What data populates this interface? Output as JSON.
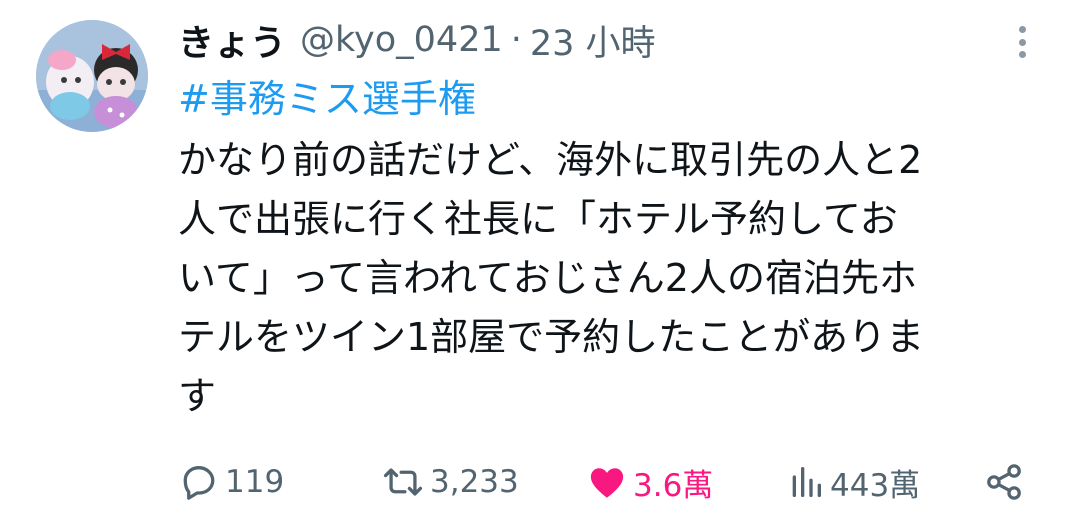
{
  "tweet": {
    "author_name": "きょう",
    "handle": "@kyo_0421",
    "separator": "·",
    "time": "23 小時",
    "hashtag": "#事務ミス選手権",
    "body_lines": [
      "かなり前の話だけど、海外に取引先の人と2",
      "人で出張に行く社長に「ホテル予約してお",
      "いて」って言われておじさん2人の宿泊先ホ",
      "テルをツイン1部屋で予約したことがありま",
      "す"
    ]
  },
  "actions": {
    "reply_count": "119",
    "retweet_count": "3,233",
    "like_count": "3.6萬",
    "like_state": "liked",
    "views_count": "443萬"
  },
  "icons": {
    "avatar": "avatar-photo-plush-dolls",
    "more": "more-vertical-icon",
    "reply": "reply-icon",
    "retweet": "retweet-icon",
    "like": "heart-icon",
    "views": "views-icon",
    "share": "share-icon"
  },
  "colors": {
    "link": "#1d9bf0",
    "like": "#f91880",
    "secondary_text": "#536471",
    "primary_text": "#0f1419"
  }
}
